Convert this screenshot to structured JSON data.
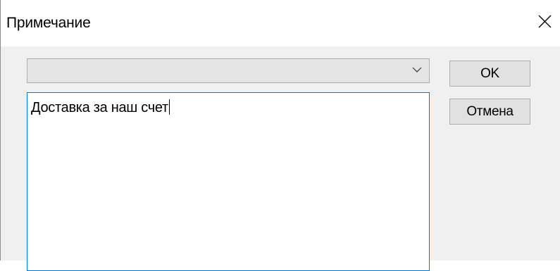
{
  "dialog": {
    "title": "Примечание",
    "close_icon": "close-icon"
  },
  "combo": {
    "selected_value": "",
    "arrow_icon": "chevron-down-icon"
  },
  "memo": {
    "text": "Доставка за наш счет"
  },
  "buttons": {
    "ok_label": "OK",
    "cancel_label": "Отмена"
  },
  "colors": {
    "focus_border": "#0078d7",
    "button_face": "#e1e1e1",
    "dialog_background": "#f0f0f0"
  }
}
